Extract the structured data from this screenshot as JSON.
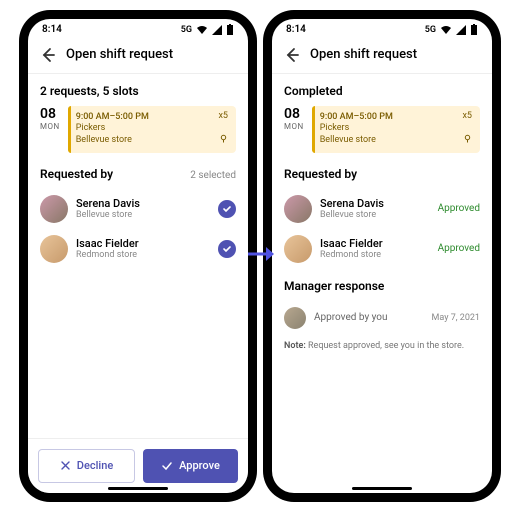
{
  "statusbar": {
    "time": "8:14",
    "net": "5G"
  },
  "header": {
    "title": "Open shift request"
  },
  "left": {
    "summary": "2 requests, 5 slots",
    "date": {
      "day": "08",
      "dow": "MON"
    },
    "shift": {
      "time": "9:00 AM–5:00 PM",
      "role": "Pickers",
      "location": "Bellevue store",
      "slots": "x5"
    },
    "requested_by_title": "Requested by",
    "selected_count": "2 selected",
    "people": [
      {
        "name": "Serena Davis",
        "loc": "Bellevue store"
      },
      {
        "name": "Isaac Fielder",
        "loc": "Redmond store"
      }
    ],
    "actions": {
      "decline": "Decline",
      "approve": "Approve"
    }
  },
  "right": {
    "summary": "Completed",
    "date": {
      "day": "08",
      "dow": "MON"
    },
    "shift": {
      "time": "9:00 AM–5:00 PM",
      "role": "Pickers",
      "location": "Bellevue store",
      "slots": "x5"
    },
    "requested_by_title": "Requested by",
    "people": [
      {
        "name": "Serena Davis",
        "loc": "Bellevue store",
        "status": "Approved"
      },
      {
        "name": "Isaac Fielder",
        "loc": "Redmond store",
        "status": "Approved"
      }
    ],
    "manager_title": "Manager response",
    "manager_line": "Approved by you",
    "manager_date": "May 7, 2021",
    "note_label": "Note:",
    "note_text": " Request approved, see you in the store."
  }
}
